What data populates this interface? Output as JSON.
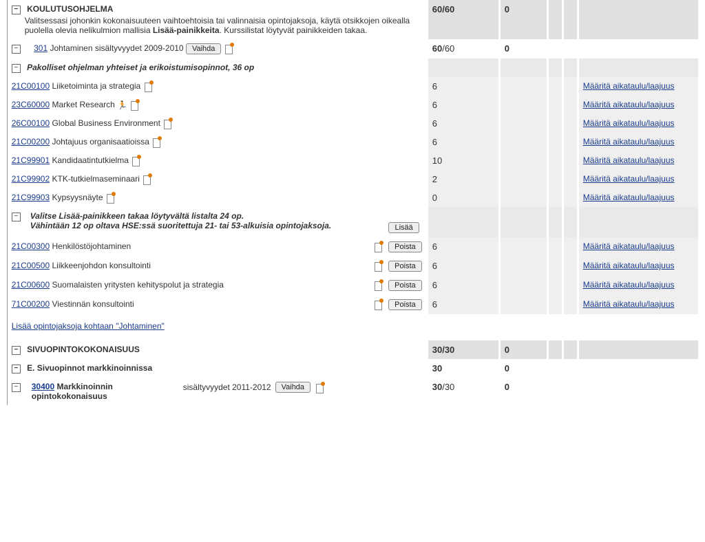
{
  "sections": {
    "koulutus": {
      "title": "KOULUTUSOHJELMA",
      "desc_a": "Valitsessasi johonkin kokonaisuuteen vaihtoehtoisia tai valinnaisia opintojaksoja, käytä otsikkojen oikealla puolella olevia nelikulmion mallisia ",
      "desc_b": "Lisää-painikkeita",
      "desc_c": ". Kurssilistat löytyvät painikkeiden takaa.",
      "credits1": "60/60",
      "credits2": "0"
    },
    "sub301": {
      "code": "301",
      "label": "Johtaminen sisältyvyydet 2009-2010",
      "btn": "Vaihda",
      "credits1a": "60",
      "credits1b": "/60",
      "credits2": "0"
    },
    "pakolliset": {
      "title": "Pakolliset ohjelman yhteiset ja erikoistumisopinnot, 36 op"
    },
    "elective": {
      "line1": "Valitse Lisää-painikkeen takaa löytyvältä listalta 24 op.",
      "line2": "Vähintään 12 op oltava HSE:ssä suoritettuja 21- tai 53-alkuisia opintojaksoja.",
      "btn": "Lisää"
    },
    "bottomlink": "Lisää opintojaksoja kohtaan \"Johtaminen\"",
    "sivu": {
      "title": "SIVUOPINTOKOKONAISUUS",
      "credits1": "30/30",
      "credits2": "0"
    },
    "sivuE": {
      "title": "E. Sivuopinnot markkinoinnissa",
      "credits1": "30",
      "credits2": "0"
    },
    "sub30400": {
      "code": "30400",
      "label1": "Markkinoinnin opintokokonaisuus",
      "label2": "sisältyvyydet 2011-2012",
      "btn": "Vaihda",
      "credits1a": "30",
      "credits1b": "/30",
      "credits2": "0"
    }
  },
  "courses": [
    {
      "code": "21C00100",
      "name": "Liiketoiminta ja strategia",
      "run": false,
      "credits": "6",
      "removable": false
    },
    {
      "code": "23C60000",
      "name": "Market Research",
      "run": true,
      "credits": "6",
      "removable": false
    },
    {
      "code": "26C00100",
      "name": "Global Business Environment",
      "run": false,
      "credits": "6",
      "removable": false
    },
    {
      "code": "21C00200",
      "name": "Johtajuus organisaatioissa",
      "run": false,
      "credits": "6",
      "removable": false
    },
    {
      "code": "21C99901",
      "name": "Kandidaatintutkielma",
      "run": false,
      "credits": "10",
      "removable": false
    },
    {
      "code": "21C99902",
      "name": "KTK-tutkielmaseminaari",
      "run": false,
      "credits": "2",
      "removable": false
    },
    {
      "code": "21C99903",
      "name": "Kypsyysnäyte",
      "run": false,
      "credits": "0",
      "removable": false
    }
  ],
  "electives": [
    {
      "code": "21C00300",
      "name": "Henkilöstöjohtaminen",
      "credits": "6"
    },
    {
      "code": "21C00500",
      "name": "Liikkeenjohdon konsultointi",
      "credits": "6"
    },
    {
      "code": "21C00600",
      "name": "Suomalaisten yritysten kehityspolut ja strategia",
      "credits": "6"
    },
    {
      "code": "71C00200",
      "name": "Viestinnän konsultointi",
      "credits": "6"
    }
  ],
  "labels": {
    "define": "Määritä aikataulu/laajuus",
    "remove": "Poista"
  }
}
